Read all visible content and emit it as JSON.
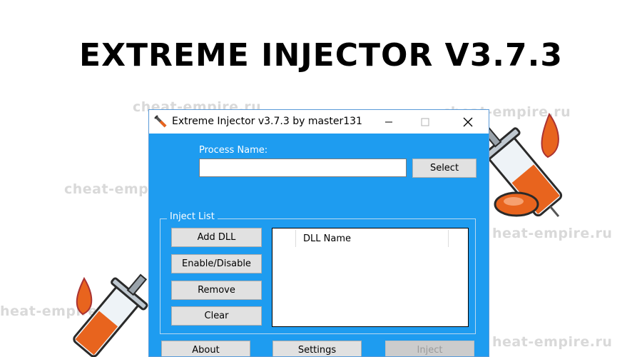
{
  "headline": "EXTREME INJECTOR V3.7.3",
  "watermark": "cheat-empire.ru",
  "watermark_partial": "cheat-emp",
  "watermark_cut": "heat-empire.ru",
  "window": {
    "title": "Extreme Injector v3.7.3 by master131",
    "controls": {
      "minimize": "minimize-icon",
      "maximize": "maximize-icon",
      "close": "close-icon"
    }
  },
  "process": {
    "label": "Process Name:",
    "value": "",
    "select_label": "Select"
  },
  "inject_list": {
    "title": "Inject List",
    "buttons": {
      "add": "Add DLL",
      "toggle": "Enable/Disable",
      "remove": "Remove",
      "clear": "Clear"
    },
    "columns": [
      "DLL Name"
    ]
  },
  "bottom": {
    "about": "About",
    "settings": "Settings",
    "inject": "Inject"
  },
  "colors": {
    "window_bg": "#1e9cf0",
    "headline": "#000000",
    "watermark": "#d9d9d9",
    "syringe_liquid": "#e8641e"
  }
}
